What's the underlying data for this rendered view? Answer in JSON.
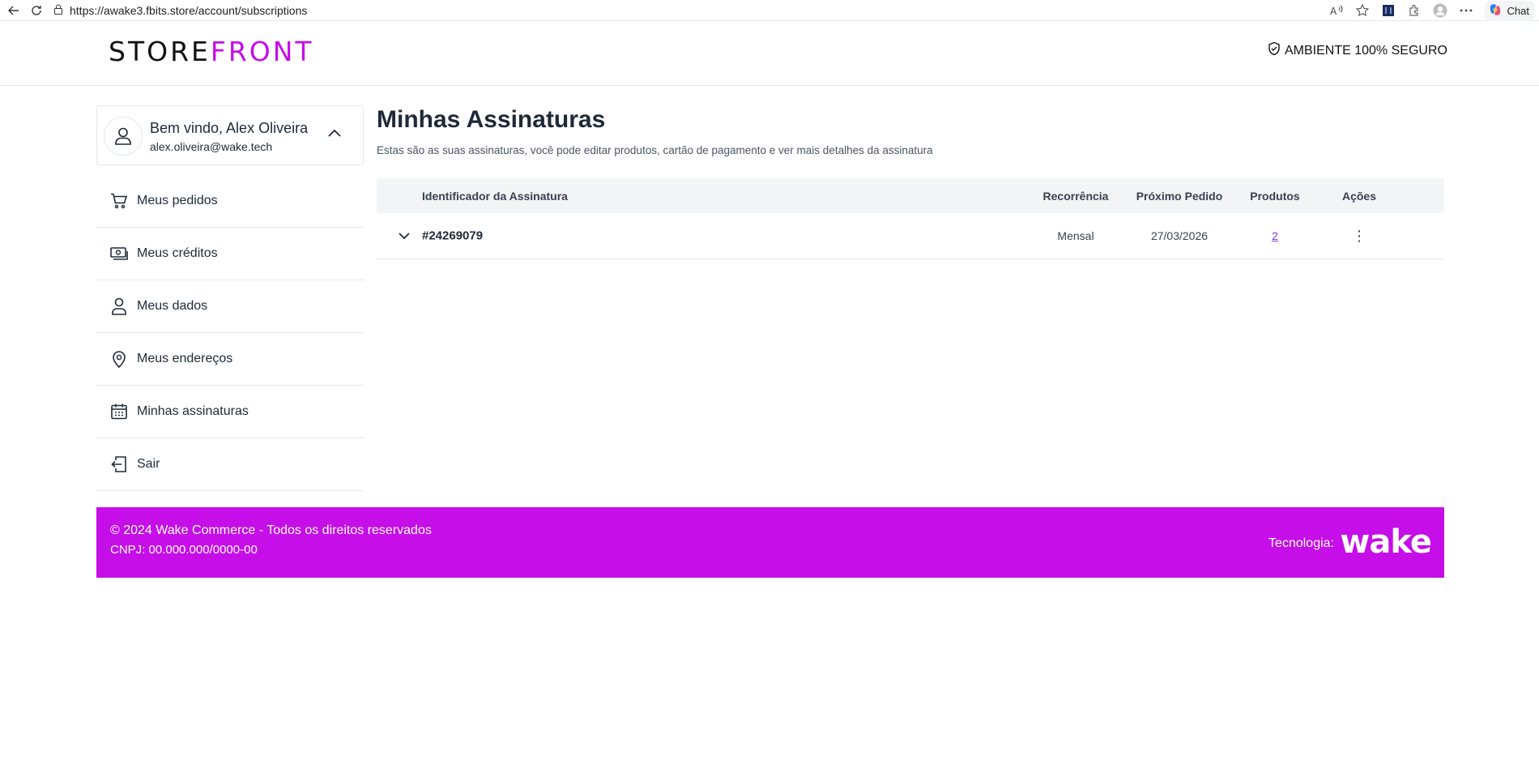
{
  "browser": {
    "url": "https://awake3.fbits.store/account/subscriptions",
    "chat_label": "Chat"
  },
  "header": {
    "logo_left": "STORE",
    "logo_right": "FRONT",
    "secure_label": "AMBIENTE 100% SEGURO"
  },
  "user": {
    "welcome": "Bem vindo, Alex Oliveira",
    "email": "alex.oliveira@wake.tech"
  },
  "sidebar": {
    "items": [
      {
        "label": "Meus pedidos",
        "icon": "cart-icon"
      },
      {
        "label": "Meus créditos",
        "icon": "money-icon"
      },
      {
        "label": "Meus dados",
        "icon": "user-icon"
      },
      {
        "label": "Meus endereços",
        "icon": "location-pin-icon"
      },
      {
        "label": "Minhas assinaturas",
        "icon": "calendar-icon"
      },
      {
        "label": "Sair",
        "icon": "logout-icon"
      }
    ]
  },
  "main": {
    "title": "Minhas Assinaturas",
    "description": "Estas são as suas assinaturas, você pode editar produtos, cartão de pagamento e ver mais detalhes da assinatura",
    "columns": {
      "id": "Identificador da Assinatura",
      "recurrence": "Recorrência",
      "next": "Próximo Pedido",
      "products": "Produtos",
      "actions": "Ações"
    },
    "rows": [
      {
        "id": "#24269079",
        "recurrence": "Mensal",
        "next": "27/03/2026",
        "products": "2",
        "actions": "⋮"
      }
    ]
  },
  "footer": {
    "copyright": "© 2024 Wake Commerce - Todos os direitos reservados",
    "cnpj": "CNPJ: 00.000.000/0000-00",
    "tech_label": "Tecnologia:",
    "brand": "wake"
  },
  "colors": {
    "brand": "#c50ee8",
    "text": "#1f2937",
    "border": "#e5e7eb",
    "table_header_bg": "#f3f4f6"
  }
}
